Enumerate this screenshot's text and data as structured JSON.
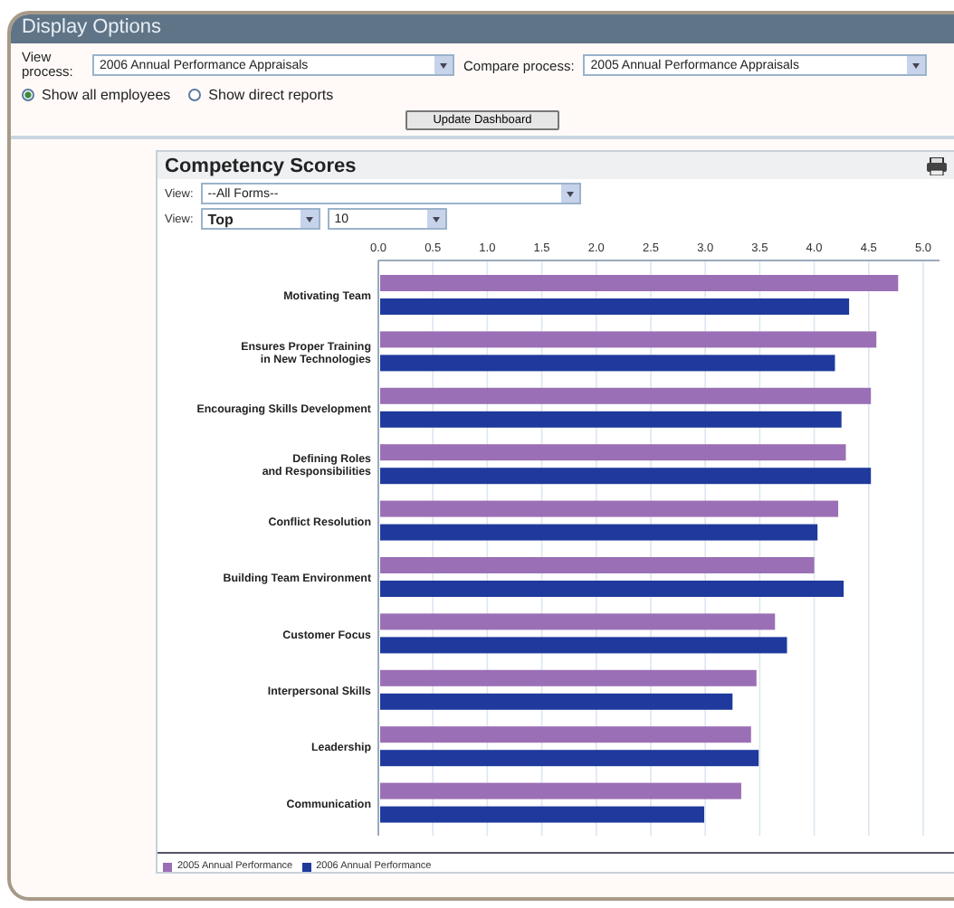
{
  "panel": {
    "title": "Display Options"
  },
  "view_process": {
    "label": "View process:",
    "value": "2006 Annual Performance Appraisals"
  },
  "compare_process": {
    "label": "Compare process:",
    "value": "2005 Annual Performance Appraisals"
  },
  "scope_options": [
    {
      "label": "Show all employees",
      "selected": true
    },
    {
      "label": "Show direct reports",
      "selected": false
    }
  ],
  "update_button": "Update Dashboard",
  "chart_panel": {
    "title": "Competency Scores",
    "form_filter": {
      "label": "View:",
      "value": "--All Forms--"
    },
    "rank_filter": {
      "label": "View:",
      "value": "Top",
      "count": "10"
    },
    "chart_data": {
      "type": "bar",
      "orientation": "horizontal",
      "categories": [
        "Motivating Team",
        "Ensures Proper Training\nin New Technologies",
        "Encouraging Skills Development",
        "Defining Roles\nand Responsibilities",
        "Conflict Resolution",
        "Building Team Environment",
        "Customer Focus",
        "Interpersonal Skills",
        "Leadership",
        "Communication"
      ],
      "xticks": [
        {
          "value": 0,
          "label": "0.0"
        },
        {
          "value": 0.5,
          "label": "0.5"
        },
        {
          "value": 1,
          "label": "1.0"
        },
        {
          "value": 1.5,
          "label": "1.5"
        },
        {
          "value": 2,
          "label": "2.0"
        },
        {
          "value": 2.5,
          "label": "2.5"
        },
        {
          "value": 3,
          "label": "3.0"
        },
        {
          "value": 3.5,
          "label": "3.5"
        },
        {
          "value": 4,
          "label": "4.0"
        },
        {
          "value": 4.5,
          "label": "4.5"
        },
        {
          "value": 5,
          "label": "5.0"
        }
      ],
      "xlim": [
        0,
        5
      ],
      "grid": true,
      "series": [
        {
          "name": "2005 Annual Performance",
          "color": "#9b6fb5",
          "values": [
            4.77,
            4.57,
            4.52,
            4.29,
            4.22,
            4.0,
            3.64,
            3.47,
            3.42,
            3.33
          ]
        },
        {
          "name": "2006 Annual Performance",
          "color": "#1f3a9c",
          "values": [
            4.32,
            4.19,
            4.25,
            4.52,
            4.03,
            4.27,
            3.75,
            3.25,
            3.49,
            2.99
          ]
        }
      ]
    }
  }
}
